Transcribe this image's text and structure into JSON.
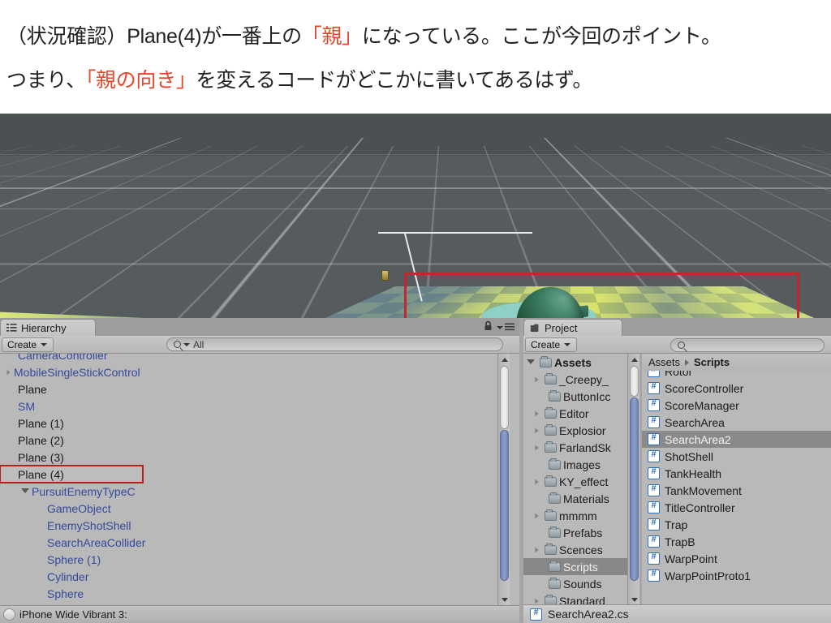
{
  "caption": {
    "line1_a": "（状況確認）Plane(4)が一番上の",
    "line1_hl": "「親」",
    "line1_b": "になっている。ここが今回のポイント。",
    "line2_a": "つまり、",
    "line2_hl": "「親の向き」",
    "line2_b": "を変えるコードがどこかに書いてあるはず。",
    "highlight_color": "#e8462b"
  },
  "scene": {
    "annotation_box_color": "#c1272d"
  },
  "hierarchy": {
    "tab_label": "Hierarchy",
    "create_label": "Create",
    "search_value": "All",
    "lock_icon": "lock-icon",
    "menu_icon": "hamburger-menu-icon",
    "status_text": "iPhone Wide Vibrant 3:",
    "items": [
      {
        "label": "CameraController",
        "prefab": true,
        "indent": 0,
        "arrow": "none",
        "selected": false,
        "clipped": true
      },
      {
        "label": "MobileSingleStickControl",
        "prefab": true,
        "indent": 0,
        "arrow": "closed",
        "selected": false
      },
      {
        "label": "Plane",
        "prefab": false,
        "indent": 0,
        "arrow": "none",
        "selected": false
      },
      {
        "label": "SM",
        "prefab": true,
        "indent": 0,
        "arrow": "none",
        "selected": false
      },
      {
        "label": "Plane (1)",
        "prefab": false,
        "indent": 0,
        "arrow": "none",
        "selected": false
      },
      {
        "label": "Plane (2)",
        "prefab": false,
        "indent": 0,
        "arrow": "none",
        "selected": false
      },
      {
        "label": "Plane (3)",
        "prefab": false,
        "indent": 0,
        "arrow": "none",
        "selected": false
      },
      {
        "label": "Plane (4)",
        "prefab": false,
        "indent": 0,
        "arrow": "none",
        "selected": true
      },
      {
        "label": "PursuitEnemyTypeC",
        "prefab": true,
        "indent": 1,
        "arrow": "open",
        "selected": false
      },
      {
        "label": "GameObject",
        "prefab": true,
        "indent": 2,
        "arrow": "none",
        "selected": false
      },
      {
        "label": "EnemyShotShell",
        "prefab": true,
        "indent": 2,
        "arrow": "none",
        "selected": false
      },
      {
        "label": "SearchAreaCollider",
        "prefab": true,
        "indent": 2,
        "arrow": "none",
        "selected": false
      },
      {
        "label": "Sphere (1)",
        "prefab": true,
        "indent": 2,
        "arrow": "none",
        "selected": false
      },
      {
        "label": "Cylinder",
        "prefab": true,
        "indent": 2,
        "arrow": "none",
        "selected": false
      },
      {
        "label": "Sphere",
        "prefab": true,
        "indent": 2,
        "arrow": "none",
        "selected": false
      }
    ]
  },
  "project": {
    "tab_label": "Project",
    "create_label": "Create",
    "search_value": "",
    "breadcrumb_root": "Assets",
    "breadcrumb_current": "Scripts",
    "status_file": "SearchArea2.cs",
    "tree": [
      {
        "label": "Assets",
        "indent": 0,
        "arrow": "open",
        "selected": false,
        "root": true
      },
      {
        "label": "_Creepy_",
        "indent": 1,
        "arrow": "closed",
        "selected": false
      },
      {
        "label": "ButtonIcc",
        "indent": 1,
        "arrow": "none",
        "selected": false
      },
      {
        "label": "Editor",
        "indent": 1,
        "arrow": "closed",
        "selected": false
      },
      {
        "label": "Explosior",
        "indent": 1,
        "arrow": "closed",
        "selected": false
      },
      {
        "label": "FarlandSk",
        "indent": 1,
        "arrow": "closed",
        "selected": false
      },
      {
        "label": "Images",
        "indent": 1,
        "arrow": "none",
        "selected": false
      },
      {
        "label": "KY_effect",
        "indent": 1,
        "arrow": "closed",
        "selected": false
      },
      {
        "label": "Materials",
        "indent": 1,
        "arrow": "none",
        "selected": false
      },
      {
        "label": "mmmm",
        "indent": 1,
        "arrow": "closed",
        "selected": false
      },
      {
        "label": "Prefabs",
        "indent": 1,
        "arrow": "none",
        "selected": false
      },
      {
        "label": "Scences",
        "indent": 1,
        "arrow": "closed",
        "selected": false
      },
      {
        "label": "Scripts",
        "indent": 1,
        "arrow": "none",
        "selected": true
      },
      {
        "label": "Sounds",
        "indent": 1,
        "arrow": "none",
        "selected": false
      },
      {
        "label": "Standard",
        "indent": 1,
        "arrow": "closed",
        "selected": false
      }
    ],
    "assets": [
      {
        "label": "Rotor",
        "selected": false,
        "clipped": true
      },
      {
        "label": "ScoreController",
        "selected": false
      },
      {
        "label": "ScoreManager",
        "selected": false
      },
      {
        "label": "SearchArea",
        "selected": false
      },
      {
        "label": "SearchArea2",
        "selected": true
      },
      {
        "label": "ShotShell",
        "selected": false
      },
      {
        "label": "TankHealth",
        "selected": false
      },
      {
        "label": "TankMovement",
        "selected": false
      },
      {
        "label": "TitleController",
        "selected": false
      },
      {
        "label": "Trap",
        "selected": false
      },
      {
        "label": "TrapB",
        "selected": false
      },
      {
        "label": "WarpPoint",
        "selected": false
      },
      {
        "label": "WarpPointProto1",
        "selected": false,
        "clipped": true
      }
    ]
  }
}
